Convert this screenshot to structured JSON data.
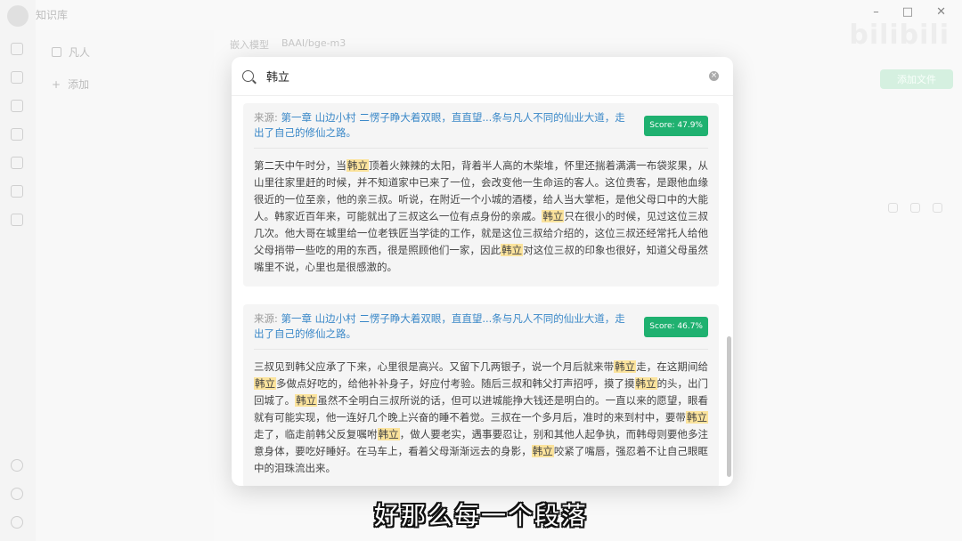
{
  "app": {
    "title": "知识库",
    "kb_items": [
      "凡人",
      "添加"
    ],
    "model_label": "嵌入模型",
    "model_value": "BAAI/bge-m3",
    "watermark": "bilibili",
    "add_button": "添加文件"
  },
  "search": {
    "query": "韩立"
  },
  "results": [
    {
      "source_label": "来源:",
      "source_title": "第一章 山边小村 二愣子睁大着双眼，直直望...条与凡人不同的仙业大道，走出了自己的修仙之路。",
      "score": "Score: 47.9%",
      "segments": [
        {
          "t": "第二天中午时分，当",
          "h": false
        },
        {
          "t": "韩立",
          "h": true
        },
        {
          "t": "顶着火辣辣的太阳，背着半人高的木柴堆，怀里还揣着满满一布袋浆果，从山里往家里赶的时候，并不知道家中已来了一位，会改变他一生命运的客人。这位贵客，是跟他血缘很近的一位至亲，他的亲三叔。听说，在附近一个小城的酒楼，给人当大掌柜，是他父母口中的大能人。韩家近百年来，可能就出了三叔这么一位有点身份的亲戚。",
          "h": false
        },
        {
          "t": "韩立",
          "h": true
        },
        {
          "t": "只在很小的时候，见过这位三叔几次。他大哥在城里给一位老铁匠当学徒的工作，就是这位三叔给介绍的，这位三叔还经常托人给他父母捎带一些吃的用的东西，很是照顾他们一家，因此",
          "h": false
        },
        {
          "t": "韩立",
          "h": true
        },
        {
          "t": "对这位三叔的印象也很好，知道父母虽然嘴里不说，心里也是很感激的。",
          "h": false
        }
      ]
    },
    {
      "source_label": "来源:",
      "source_title": "第一章 山边小村 二愣子睁大着双眼，直直望...条与凡人不同的仙业大道，走出了自己的修仙之路。",
      "score": "Score: 46.7%",
      "segments": [
        {
          "t": "三叔见到韩父应承了下来，心里很是高兴。又留下几两银子，说一个月后就来带",
          "h": false
        },
        {
          "t": "韩立",
          "h": true
        },
        {
          "t": "走，在这期间给",
          "h": false
        },
        {
          "t": "韩立",
          "h": true
        },
        {
          "t": "多做点好吃的，给他补补身子，好应付考验。随后三叔和韩父打声招呼，摸了摸",
          "h": false
        },
        {
          "t": "韩立",
          "h": true
        },
        {
          "t": "的头，出门回城了。",
          "h": false
        },
        {
          "t": "韩立",
          "h": true
        },
        {
          "t": "虽然不全明白三叔所说的话，但可以进城能挣大钱还是明白的。一直以来的愿望，眼看就有可能实现，他一连好几个晚上兴奋的睡不着觉。三叔在一个多月后，准时的来到村中，要带",
          "h": false
        },
        {
          "t": "韩立",
          "h": true
        },
        {
          "t": "走了，临走前韩父反复嘱咐",
          "h": false
        },
        {
          "t": "韩立",
          "h": true
        },
        {
          "t": "，做人要老实，遇事要忍让，别和其他人起争执，而韩母则要他多注意身体，要吃好睡好。在马车上，看着父母渐渐远去的身影，",
          "h": false
        },
        {
          "t": "韩立",
          "h": true
        },
        {
          "t": "咬紧了嘴唇，强忍着不让自己眼眶中的泪珠流出来。",
          "h": false
        }
      ]
    }
  ],
  "subtitle": "好那么每一个段落",
  "colors": {
    "accent_green": "#1fb170",
    "link_blue": "#3a88c8",
    "highlight": "#fbe39c"
  }
}
